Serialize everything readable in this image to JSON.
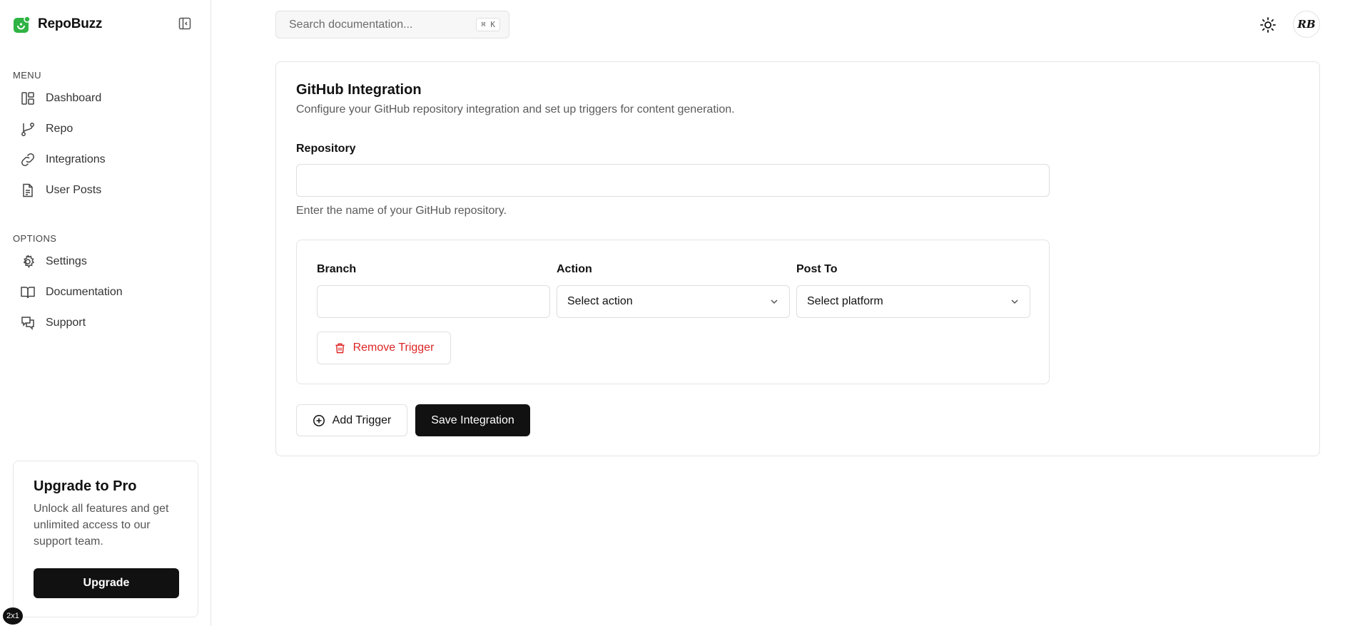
{
  "brand": {
    "name": "RepoBuzz",
    "accent": "#2fb344"
  },
  "sidebar": {
    "menu_label": "MENU",
    "menu_items": [
      {
        "label": "Dashboard",
        "icon": "dashboard-icon"
      },
      {
        "label": "Repo",
        "icon": "git-branch-icon"
      },
      {
        "label": "Integrations",
        "icon": "link-icon"
      },
      {
        "label": "User Posts",
        "icon": "document-icon"
      }
    ],
    "options_label": "OPTIONS",
    "option_items": [
      {
        "label": "Settings",
        "icon": "gear-icon"
      },
      {
        "label": "Documentation",
        "icon": "book-icon"
      },
      {
        "label": "Support",
        "icon": "chat-icon"
      }
    ],
    "upgrade": {
      "title": "Upgrade to Pro",
      "text": "Unlock all features and get unlimited access to our support team.",
      "button": "Upgrade"
    },
    "dev_badge": "2x1"
  },
  "topbar": {
    "search_placeholder": "Search documentation...",
    "shortcut": "⌘ K",
    "avatar_initials": "RB"
  },
  "integration": {
    "title": "GitHub Integration",
    "description": "Configure your GitHub repository integration and set up triggers for content generation.",
    "repository_label": "Repository",
    "repository_value": "",
    "repository_help": "Enter the name of your GitHub repository.",
    "trigger": {
      "branch_label": "Branch",
      "branch_value": "",
      "action_label": "Action",
      "action_value": "Select action",
      "post_to_label": "Post To",
      "post_to_value": "Select platform",
      "remove_label": "Remove Trigger"
    },
    "add_trigger_label": "Add Trigger",
    "save_label": "Save Integration"
  },
  "colors": {
    "danger": "#dc2626",
    "primary_button": "#111111"
  }
}
